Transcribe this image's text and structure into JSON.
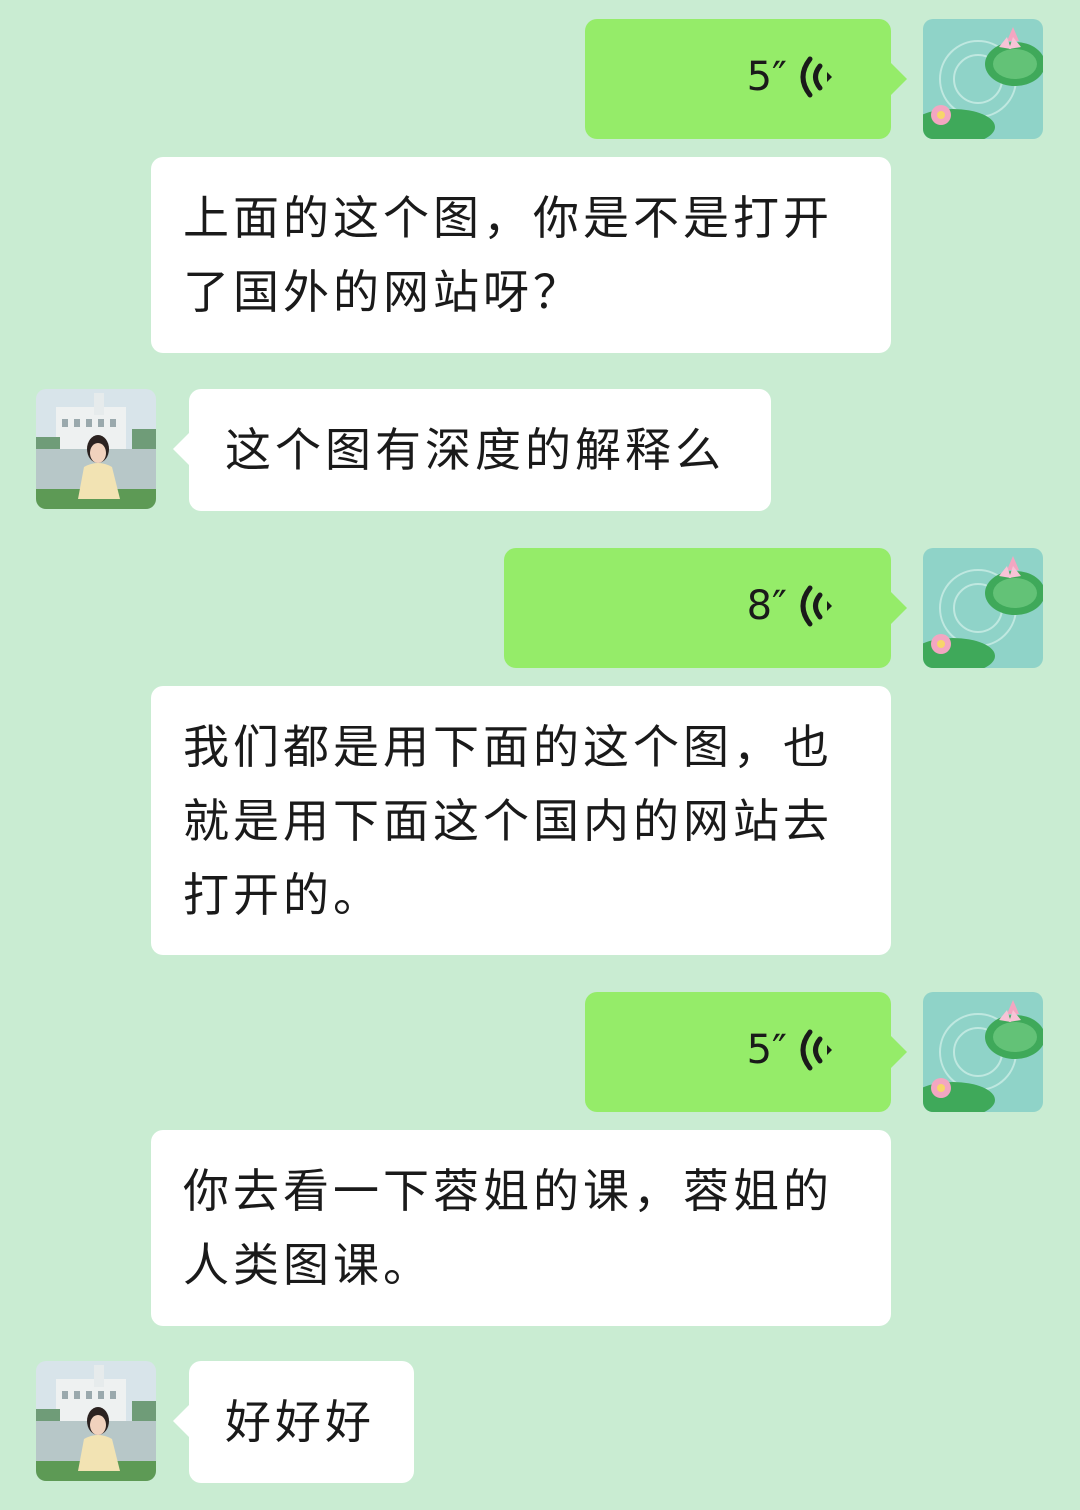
{
  "messages": [
    {
      "type": "voice",
      "side": "right",
      "duration": "5″"
    },
    {
      "type": "text",
      "side": "right",
      "text": "上面的这个图，你是不是打开了国外的网站呀？"
    },
    {
      "type": "text",
      "side": "left",
      "text": "这个图有深度的解释么"
    },
    {
      "type": "voice",
      "side": "right",
      "duration": "8″"
    },
    {
      "type": "text",
      "side": "right",
      "text": "我们都是用下面的这个图，也就是用下面这个国内的网站去打开的。"
    },
    {
      "type": "voice",
      "side": "right",
      "duration": "5″"
    },
    {
      "type": "text",
      "side": "right",
      "text": "你去看一下蓉姐的课，蓉姐的人类图课。"
    },
    {
      "type": "text",
      "side": "left",
      "text": "好好好"
    }
  ],
  "avatars": {
    "self": "lotus-pond-avatar",
    "other": "woman-by-lake-avatar"
  },
  "colors": {
    "background": "#c9ecd2",
    "sent_voice_bubble": "#95ec69",
    "text_bubble": "#ffffff"
  }
}
